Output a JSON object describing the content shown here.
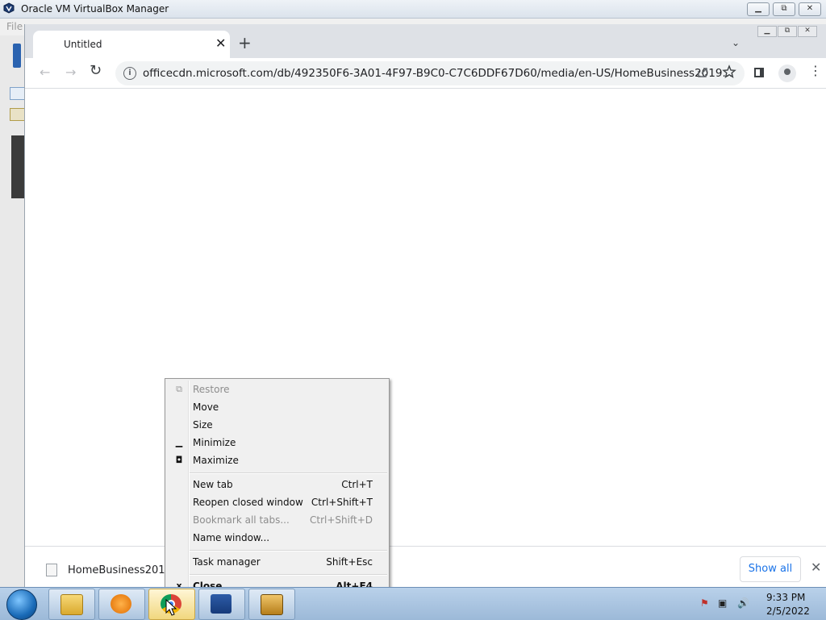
{
  "vbox": {
    "title": "Oracle VM VirtualBox Manager",
    "menu_first": "File"
  },
  "chrome": {
    "tab_title": "Untitled",
    "tab_close": "✕",
    "new_tab": "+",
    "tab_search": "⌄",
    "url": "officecdn.microsoft.com/db/492350F6-3A01-4F97-B9C0-C7C6DDF67D60/media/en-US/HomeBusiness2019...",
    "info_glyph": "i"
  },
  "download_bar": {
    "file_name": "HomeBusiness201....i",
    "show_all": "Show all",
    "close": "✕"
  },
  "context_menu": {
    "items": [
      {
        "label": "Restore",
        "shortcut": "",
        "disabled": true,
        "glyph": "⧉"
      },
      {
        "label": "Move",
        "shortcut": "",
        "disabled": false,
        "glyph": ""
      },
      {
        "label": "Size",
        "shortcut": "",
        "disabled": false,
        "glyph": ""
      },
      {
        "label": "Minimize",
        "shortcut": "",
        "disabled": false,
        "glyph": "▁"
      },
      {
        "label": "Maximize",
        "shortcut": "",
        "disabled": false,
        "glyph": "◘"
      },
      {
        "label": "New tab",
        "shortcut": "Ctrl+T",
        "disabled": false,
        "glyph": ""
      },
      {
        "label": "Reopen closed window",
        "shortcut": "Ctrl+Shift+T",
        "disabled": false,
        "glyph": ""
      },
      {
        "label": "Bookmark all tabs...",
        "shortcut": "Ctrl+Shift+D",
        "disabled": true,
        "glyph": ""
      },
      {
        "label": "Name window...",
        "shortcut": "",
        "disabled": false,
        "glyph": ""
      },
      {
        "label": "Task manager",
        "shortcut": "Shift+Esc",
        "disabled": false,
        "glyph": ""
      },
      {
        "label": "Close",
        "shortcut": "Alt+F4",
        "disabled": false,
        "glyph": "x"
      }
    ]
  },
  "taskbar": {
    "time": "9:33 PM",
    "date": "2/5/2022"
  },
  "colors": {
    "accent": "#1a73e8",
    "menu_bg": "#f0f0f0",
    "disabled_text": "#8d8d8d"
  }
}
